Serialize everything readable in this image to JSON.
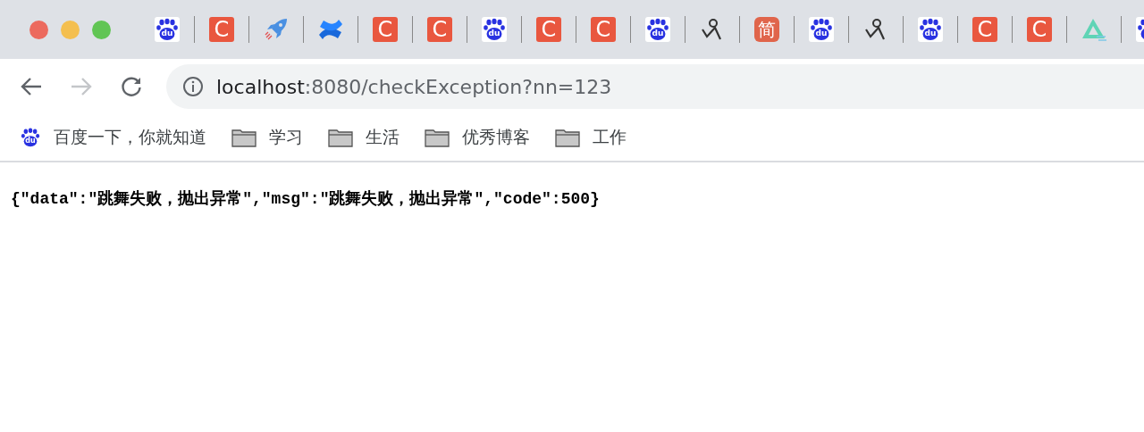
{
  "tabs": [
    {
      "kind": "baidu",
      "glyph": "du"
    },
    {
      "kind": "c",
      "glyph": "C"
    },
    {
      "kind": "rocket"
    },
    {
      "kind": "confluence"
    },
    {
      "kind": "c",
      "glyph": "C"
    },
    {
      "kind": "c",
      "glyph": "C"
    },
    {
      "kind": "baidu",
      "glyph": "du"
    },
    {
      "kind": "c",
      "glyph": "C"
    },
    {
      "kind": "c",
      "glyph": "C"
    },
    {
      "kind": "baidu",
      "glyph": "du"
    },
    {
      "kind": "pen"
    },
    {
      "kind": "jian",
      "glyph": "简"
    },
    {
      "kind": "baidu",
      "glyph": "du"
    },
    {
      "kind": "pen"
    },
    {
      "kind": "baidu",
      "glyph": "du"
    },
    {
      "kind": "c",
      "glyph": "C"
    },
    {
      "kind": "c",
      "glyph": "C"
    },
    {
      "kind": "triangle"
    },
    {
      "kind": "baidu"
    }
  ],
  "address_bar": {
    "host": "localhost",
    "rest": ":8080/checkException?nn=123"
  },
  "bookmarks": [
    {
      "kind": "baidu",
      "glyph": "du",
      "label": "百度一下，你就知道"
    },
    {
      "kind": "folder",
      "label": "学习"
    },
    {
      "kind": "folder",
      "label": "生活"
    },
    {
      "kind": "folder",
      "label": "优秀博客"
    },
    {
      "kind": "folder",
      "label": "工作"
    }
  ],
  "page_text": "{\"data\":\"跳舞失败，抛出异常\",\"msg\":\"跳舞失败，抛出异常\",\"code\":500}"
}
